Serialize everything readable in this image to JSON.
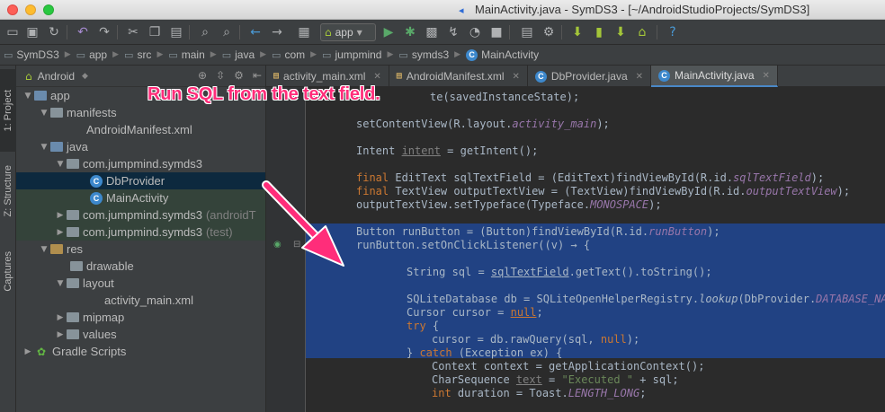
{
  "window": {
    "title": "MainActivity.java - SymDS3 - [~/AndroidStudioProjects/SymDS3]"
  },
  "toolbar": {
    "run_config": "app"
  },
  "breadcrumbs": [
    "SymDS3",
    "app",
    "src",
    "main",
    "java",
    "com",
    "jumpmind",
    "symds3",
    "MainActivity"
  ],
  "left_strip": {
    "project_tab": "1: Project",
    "structure_tab": "Z: Structure",
    "captures_tab": "Captures"
  },
  "project_panel": {
    "view_mode": "Android",
    "tree": [
      {
        "label": "app",
        "suffix": ""
      },
      {
        "label": "manifests",
        "suffix": ""
      },
      {
        "label": "AndroidManifest.xml",
        "suffix": ""
      },
      {
        "label": "java",
        "suffix": ""
      },
      {
        "label": "com.jumpmind.symds3",
        "suffix": ""
      },
      {
        "label": "DbProvider",
        "suffix": ""
      },
      {
        "label": "MainActivity",
        "suffix": ""
      },
      {
        "label": "com.jumpmind.symds3",
        "suffix": "(androidT"
      },
      {
        "label": "com.jumpmind.symds3",
        "suffix": "(test)"
      },
      {
        "label": "res",
        "suffix": ""
      },
      {
        "label": "drawable",
        "suffix": ""
      },
      {
        "label": "layout",
        "suffix": ""
      },
      {
        "label": "activity_main.xml",
        "suffix": ""
      },
      {
        "label": "mipmap",
        "suffix": ""
      },
      {
        "label": "values",
        "suffix": ""
      },
      {
        "label": "Gradle Scripts",
        "suffix": ""
      }
    ]
  },
  "tabs": [
    {
      "label": "activity_main.xml"
    },
    {
      "label": "AndroidManifest.xml"
    },
    {
      "label": "DbProvider.java"
    },
    {
      "label": "MainActivity.java"
    }
  ],
  "annotation": {
    "text": "Run SQL from the text field."
  },
  "code": {
    "l0a": "te(savedInstanceState);",
    "l1a": "setContentView(R.layout.",
    "l1b": "activity_main",
    "l1c": ");",
    "l2a": "Intent ",
    "l2b": "intent",
    "l2c": " = getIntent();",
    "l3a": "final ",
    "l3b": "EditText sqlTextField = (EditText)findViewById(R.id.",
    "l3c": "sqlTextField",
    "l3d": ");",
    "l4a": "final ",
    "l4b": "TextView outputTextView = (TextView)findViewById(R.id.",
    "l4c": "outputTextView",
    "l4d": ");",
    "l5a": "outputTextView.setTypeface(Typeface.",
    "l5b": "MONOSPACE",
    "l5c": ");",
    "l6a": "Button runButton = (Button)findViewById(R.id.",
    "l6b": "runButton",
    "l6c": ");",
    "l7a": "runButton.setOnClickListener((v) → {",
    "l8a": "String sql = ",
    "l8b": "sqlTextField",
    "l8c": ".getText().toString();",
    "l9a": "SQLiteDatabase db = SQLiteOpenHelperRegistry.",
    "l9b": "lookup",
    "l9c": "(DbProvider.",
    "l9d": "DATABASE_NAME",
    "l10a": "Cursor cursor = ",
    "l10b": "null",
    "l10c": ";",
    "l11a": "try",
    "l11b": " {",
    "l12a": "cursor = db.rawQuery(sql, ",
    "l12b": "null",
    "l12c": ");",
    "l13a": "} ",
    "l13b": "catch",
    "l13c": " (Exception ex) {",
    "l14a": "Context context = getApplicationContext();",
    "l15a": "CharSequence ",
    "l15b": "text",
    "l15c": " = ",
    "l15d": "\"Executed \"",
    "l15e": " + sql;",
    "l16a": "int ",
    "l16b": "duration = Toast.",
    "l16c": "LENGTH_LONG",
    "l16d": ";"
  },
  "colors": {
    "accent": "#ff2d7a",
    "selection": "#214283",
    "keyword": "#cc7832",
    "field": "#9876aa",
    "string": "#6a8759"
  }
}
